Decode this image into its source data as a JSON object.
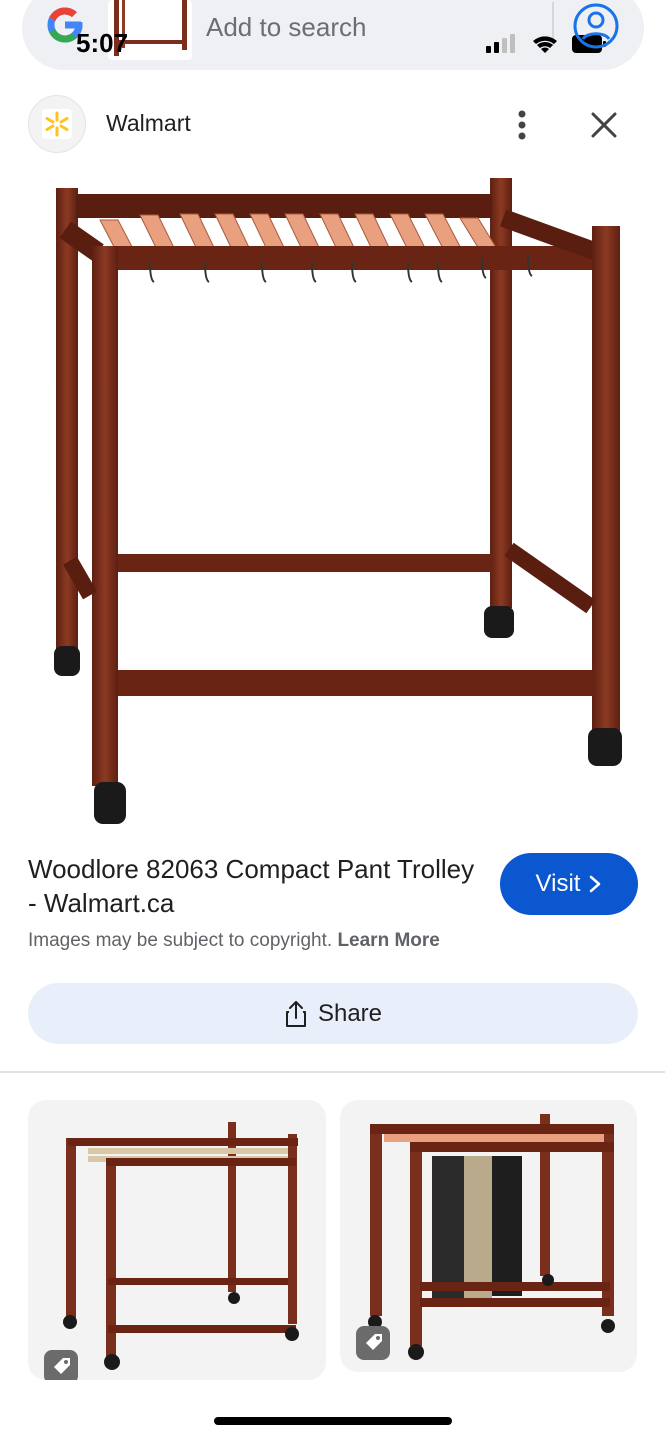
{
  "status_bar": {
    "time": "5:07"
  },
  "search_bar": {
    "logo": "google-g-icon",
    "placeholder": "Add to search",
    "avatar_icon": "account-circle-icon"
  },
  "source": {
    "name": "Walmart",
    "logo_icon": "walmart-spark-icon",
    "more_icon": "more-vert-icon",
    "close_icon": "close-icon"
  },
  "product": {
    "title": "Woodlore 82063 Compact Pant Trolley - Walmart.ca",
    "visit_label": "Visit",
    "copyright_text": "Images may be subject to copyright.",
    "learn_more_label": "Learn More",
    "share_label": "Share"
  },
  "colors": {
    "accent": "#0b57d0",
    "share_bg": "#e8effb",
    "wood": "#7a2e1c"
  }
}
